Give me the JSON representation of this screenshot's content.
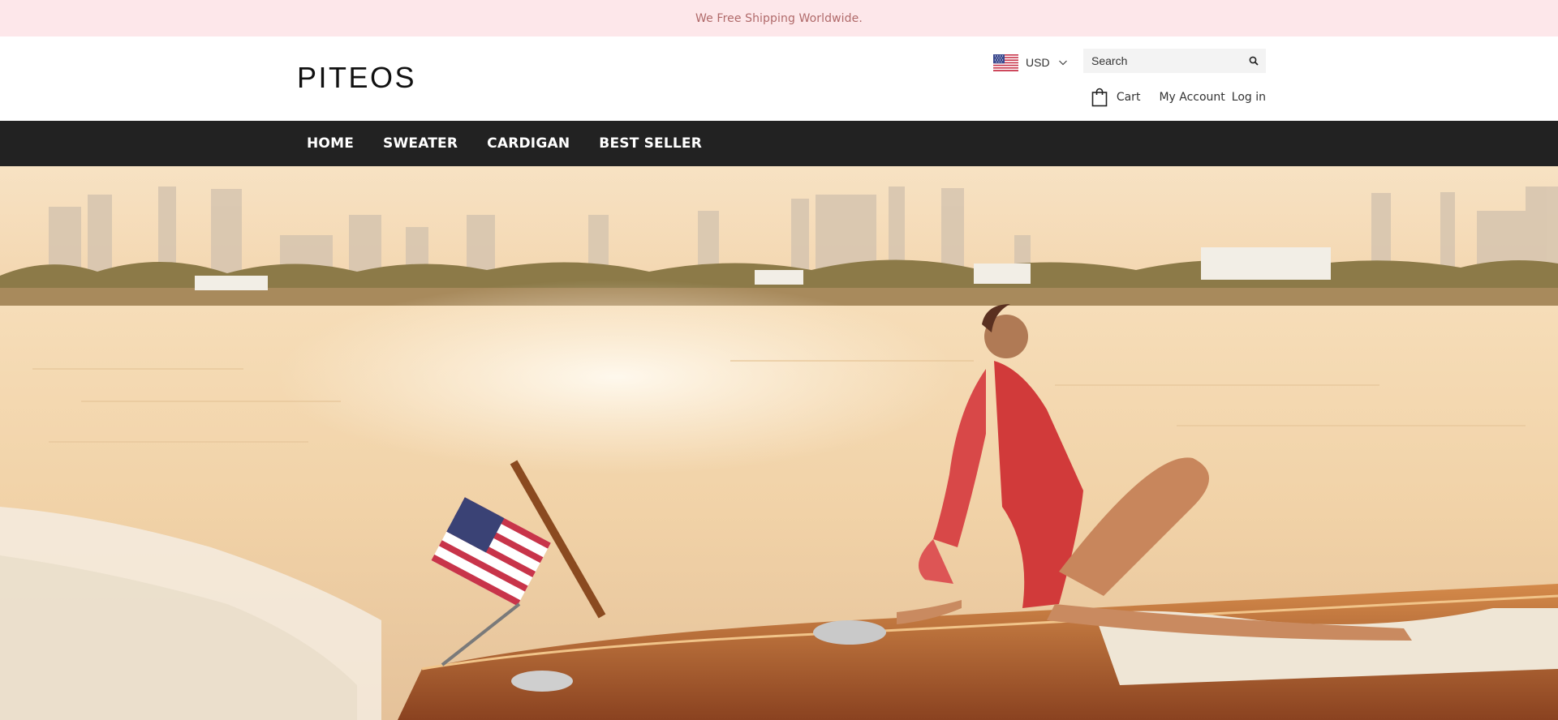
{
  "announcement": {
    "text": "We Free Shipping Worldwide."
  },
  "brand": {
    "logo_text": "PITEOS"
  },
  "currency": {
    "code": "USD",
    "flag_icon": "us-flag-icon"
  },
  "search": {
    "placeholder": "Search"
  },
  "header_links": {
    "cart": "Cart",
    "account": "My Account",
    "login": "Log in"
  },
  "nav": {
    "items": [
      {
        "label": "HOME"
      },
      {
        "label": "SWEATER"
      },
      {
        "label": "CARDIGAN"
      },
      {
        "label": "BEST SELLER"
      }
    ]
  },
  "colors": {
    "announcement_bg": "#fde7ea",
    "announcement_text": "#b06a6a",
    "nav_bg": "#222222",
    "nav_text": "#ffffff"
  }
}
